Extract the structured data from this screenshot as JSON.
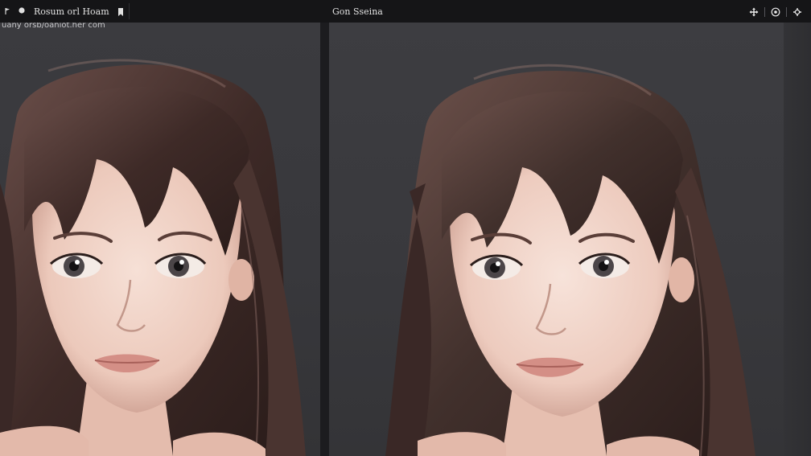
{
  "header": {
    "left_title": "Rosum orl Hoam",
    "center_title": "Gon Sseina"
  },
  "left_panel": {
    "caption": "uany orsb/oaniot.her com"
  },
  "icons": {
    "left": [
      "small-flag-icon",
      "dot-icon",
      "bookmark-icon"
    ],
    "right": [
      "move-icon",
      "info-icon",
      "settings-icon"
    ]
  },
  "colors": {
    "background": "#121214",
    "panel": "#3a3a3e",
    "hair": "#4a3430",
    "skin": "#f2d6cb"
  }
}
